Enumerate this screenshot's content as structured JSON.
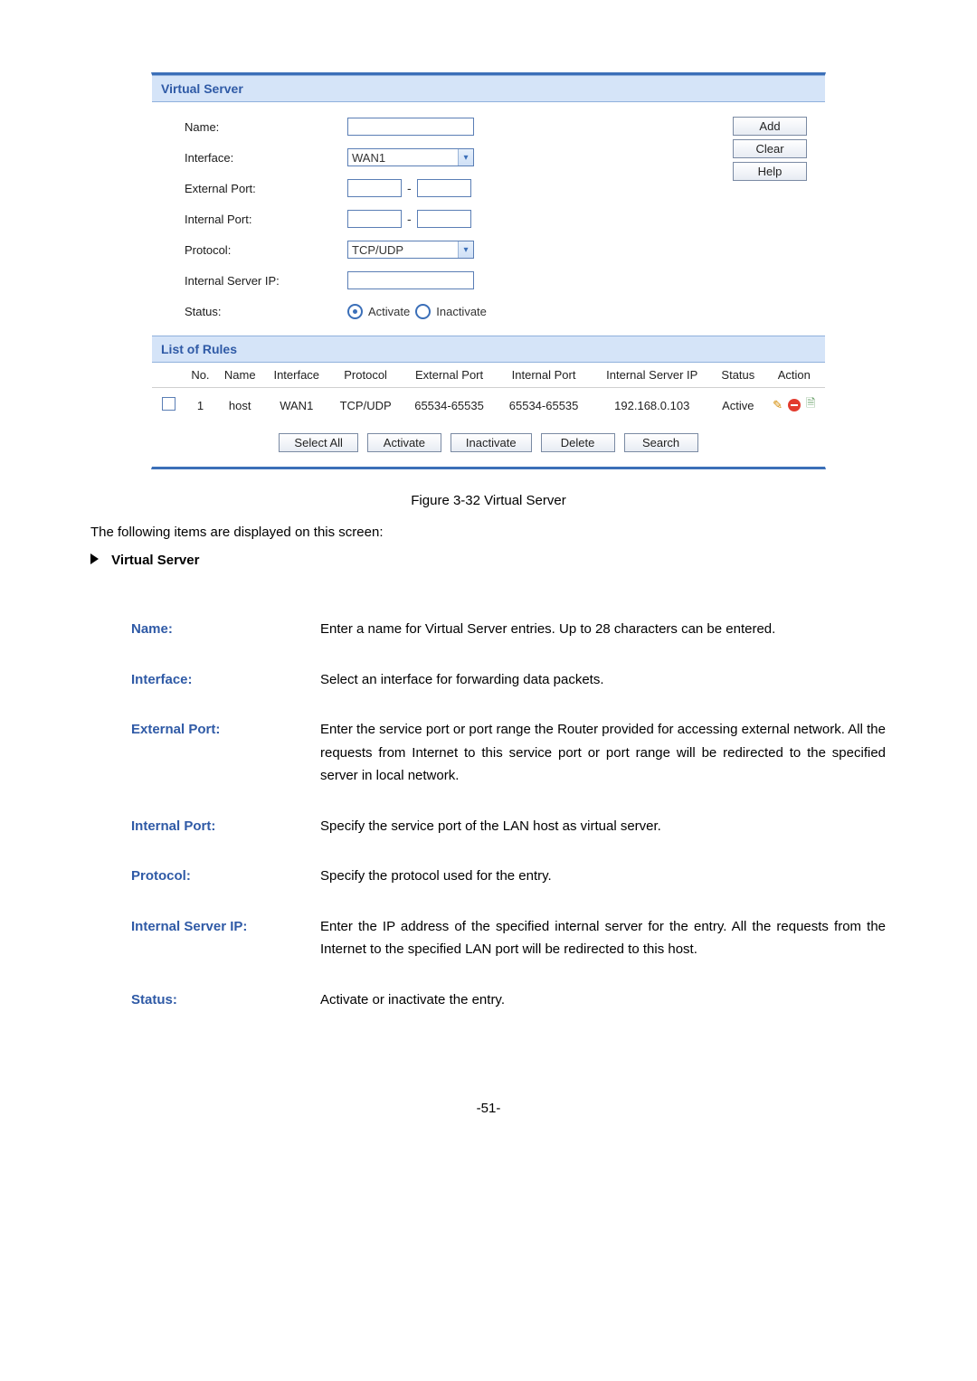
{
  "panel": {
    "title": "Virtual Server",
    "form": {
      "name_label": "Name:",
      "name_value": "",
      "interface_label": "Interface:",
      "interface_value": "WAN1",
      "ext_port_label": "External Port:",
      "ext_port_from": "",
      "ext_port_to": "",
      "int_port_label": "Internal Port:",
      "int_port_from": "",
      "int_port_to": "",
      "protocol_label": "Protocol:",
      "protocol_value": "TCP/UDP",
      "server_ip_label": "Internal Server IP:",
      "server_ip_value": "",
      "status_label": "Status:",
      "status_activate": "Activate",
      "status_inactivate": "Inactivate"
    },
    "buttons": {
      "add": "Add",
      "clear": "Clear",
      "help": "Help",
      "select_all": "Select All",
      "activate": "Activate",
      "inactivate": "Inactivate",
      "delete": "Delete",
      "search": "Search"
    },
    "rules_title": "List of Rules",
    "headers": {
      "no": "No.",
      "name": "Name",
      "interface": "Interface",
      "protocol": "Protocol",
      "ext_port": "External Port",
      "int_port": "Internal Port",
      "server_ip": "Internal Server IP",
      "status": "Status",
      "action": "Action"
    },
    "rows": [
      {
        "no": "1",
        "name": "host",
        "interface": "WAN1",
        "protocol": "TCP/UDP",
        "ext_port": "65534-65535",
        "int_port": "65534-65535",
        "server_ip": "192.168.0.103",
        "status": "Active"
      }
    ]
  },
  "figure_caption": "Figure 3-32 Virtual Server",
  "intro_text": "The following items are displayed on this screen:",
  "section_heading": "Virtual Server",
  "descriptions": [
    {
      "term": "Name:",
      "def": "Enter a name for Virtual Server entries. Up to 28 characters can be entered."
    },
    {
      "term": "Interface:",
      "def": "Select an interface for forwarding data packets."
    },
    {
      "term": "External Port:",
      "def": "Enter the service port or port range the Router provided for accessing external network. All the requests from Internet to this service port or port range will be redirected to the specified server in local network."
    },
    {
      "term": "Internal Port:",
      "def": "Specify the service port of the LAN host as virtual server."
    },
    {
      "term": "Protocol:",
      "def": "Specify the protocol used for the entry."
    },
    {
      "term": "Internal Server IP:",
      "def": "Enter the IP address of the specified internal server for the entry. All the requests from the Internet to the specified LAN port will be redirected to this host."
    },
    {
      "term": "Status:",
      "def": "Activate or inactivate the entry."
    }
  ],
  "page_number": "-51-"
}
